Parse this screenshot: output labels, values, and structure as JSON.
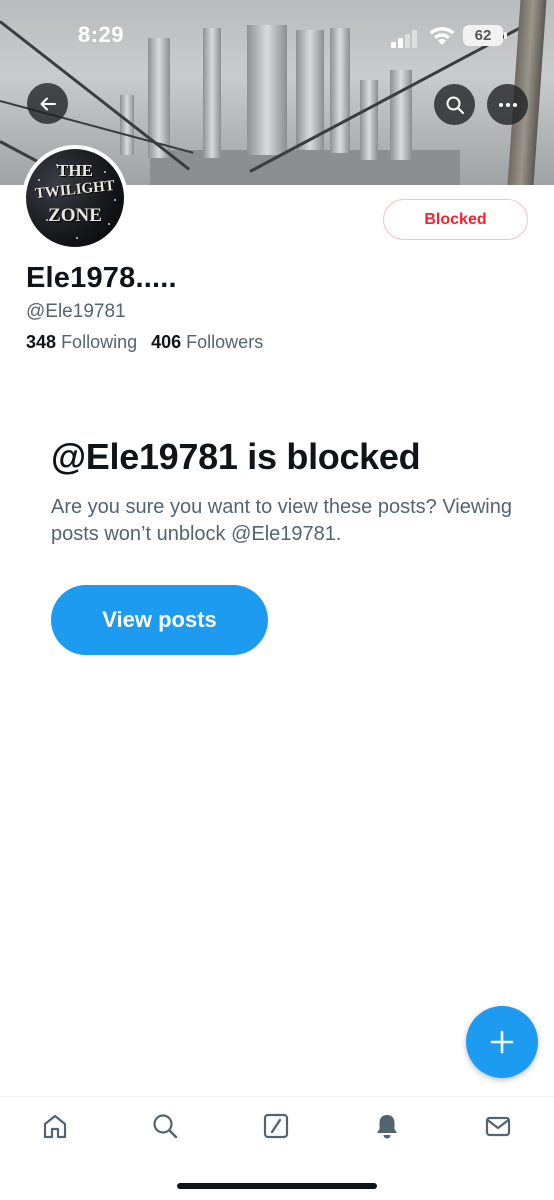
{
  "status_bar": {
    "time": "8:29",
    "battery": "62",
    "signal_icon": "cellular-signal-icon",
    "wifi_icon": "wifi-icon"
  },
  "header": {
    "back_icon": "arrow-left-icon",
    "search_icon": "search-icon",
    "more_icon": "more-horizontal-icon"
  },
  "profile": {
    "avatar_lines": [
      "THE",
      "TWILIGHT",
      "ZONE"
    ],
    "blocked_label": "Blocked",
    "display_name": "Ele1978.....",
    "handle": "@Ele19781",
    "following_count": "348",
    "following_label": "Following",
    "followers_count": "406",
    "followers_label": "Followers"
  },
  "blocked_notice": {
    "title": "@Ele19781 is blocked",
    "description": "Are you sure you want to view these posts? Viewing posts won’t unblock @Ele19781.",
    "button_label": "View posts"
  },
  "fab": {
    "icon": "plus-icon"
  },
  "bottom_nav": [
    {
      "name": "home",
      "icon": "home-icon"
    },
    {
      "name": "search",
      "icon": "search-icon"
    },
    {
      "name": "grok",
      "icon": "grok-slash-icon"
    },
    {
      "name": "notifications",
      "icon": "bell-icon"
    },
    {
      "name": "messages",
      "icon": "mail-icon"
    }
  ],
  "colors": {
    "accent": "#1d9bf0",
    "blocked_red": "#f4212e",
    "text_primary": "#0f1419",
    "text_secondary": "#536471"
  }
}
